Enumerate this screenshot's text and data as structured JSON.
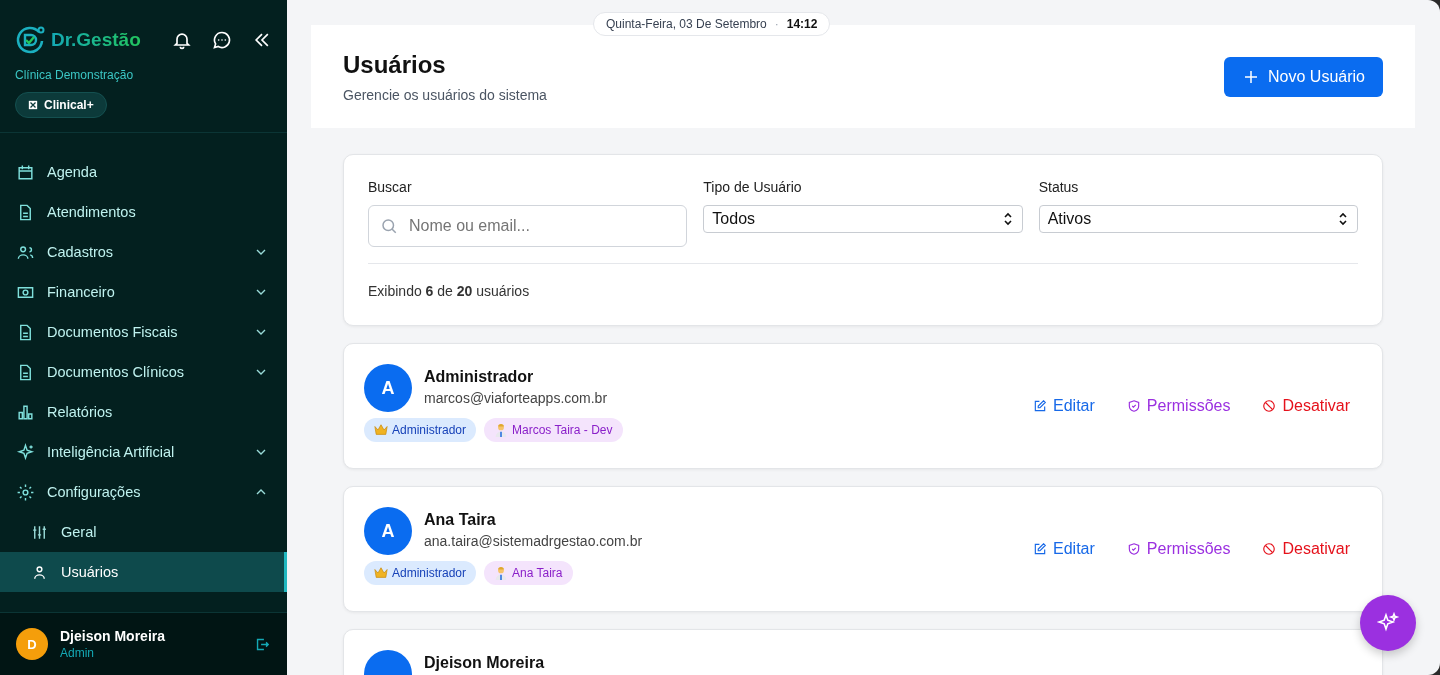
{
  "brand": {
    "name": "Dr.Gestão",
    "clinic": "Clínica Demonstração",
    "plan": "Clinical+"
  },
  "datetime": {
    "date": "Quinta-Feira, 03 De Setembro",
    "separator": "·",
    "time": "14:12"
  },
  "sidebar": {
    "items": [
      {
        "kind": "link",
        "label": "Agenda"
      },
      {
        "kind": "link",
        "label": "Atendimentos"
      },
      {
        "kind": "group",
        "label": "Cadastros",
        "expanded": false
      },
      {
        "kind": "group",
        "label": "Financeiro",
        "expanded": false
      },
      {
        "kind": "group",
        "label": "Documentos Fiscais",
        "expanded": false
      },
      {
        "kind": "group",
        "label": "Documentos Clínicos",
        "expanded": false
      },
      {
        "kind": "link",
        "label": "Relatórios"
      },
      {
        "kind": "group",
        "label": "Inteligência Artificial",
        "expanded": false
      },
      {
        "kind": "group",
        "label": "Configurações",
        "expanded": true,
        "children": [
          {
            "label": "Geral",
            "selected": false
          },
          {
            "label": "Usuários",
            "selected": true
          }
        ]
      }
    ],
    "user": {
      "initial": "D",
      "name": "Djeison Moreira",
      "role": "Admin"
    }
  },
  "page": {
    "title": "Usuários",
    "subtitle": "Gerencie os usuários do sistema",
    "new_button": "Novo Usuário"
  },
  "filters": {
    "search": {
      "label": "Buscar",
      "placeholder": "Nome ou email..."
    },
    "type": {
      "label": "Tipo de Usuário",
      "value": "Todos"
    },
    "status": {
      "label": "Status",
      "value": "Ativos"
    },
    "summary": "Exibindo **6** de **20** usuários"
  },
  "users": [
    {
      "initial": "A",
      "name": "Administrador",
      "email": "marcos@viaforteapps.com.br",
      "role_tag": "Administrador",
      "profile_tag": "Marcos Taira - Dev",
      "actions": [
        {
          "kind": "edit",
          "label": "Editar"
        },
        {
          "kind": "permissions",
          "label": "Permissões"
        },
        {
          "kind": "deactivate",
          "label": "Desativar"
        }
      ]
    },
    {
      "initial": "A",
      "name": "Ana Taira",
      "email": "ana.taira@sistemadrgestao.com.br",
      "role_tag": "Administrador",
      "profile_tag": "Ana Taira",
      "actions": [
        {
          "kind": "edit",
          "label": "Editar"
        },
        {
          "kind": "permissions",
          "label": "Permissões"
        },
        {
          "kind": "deactivate",
          "label": "Desativar"
        }
      ]
    },
    {
      "name": "Djeison Moreira"
    }
  ]
}
